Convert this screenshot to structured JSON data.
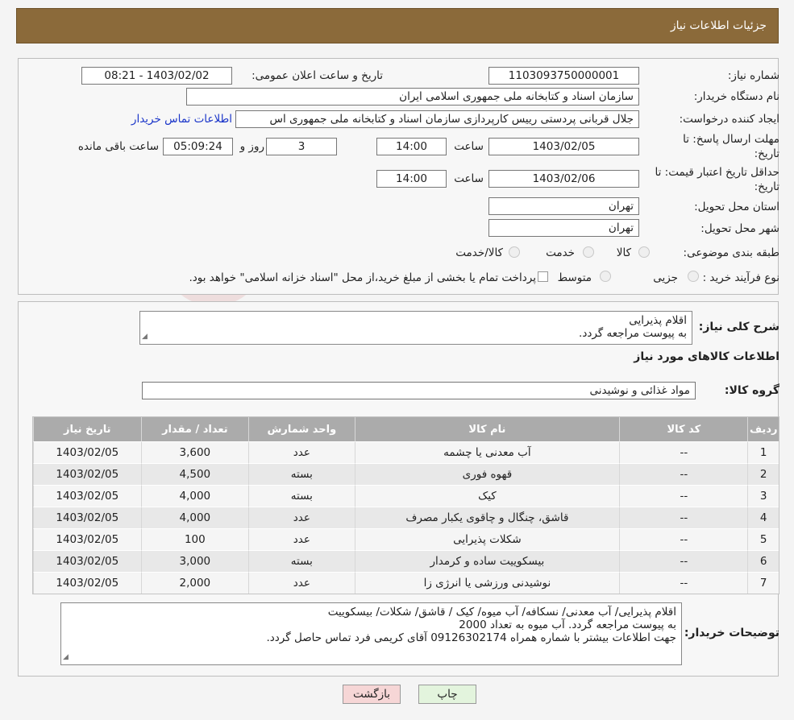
{
  "header": {
    "title": "جزئیات اطلاعات نیاز"
  },
  "form": {
    "need_number_label": "شماره نیاز:",
    "need_number": "1103093750000001",
    "announce_label": "تاریخ و ساعت اعلان عمومی:",
    "announce_value": "1403/02/02 - 08:21",
    "buyer_org_label": "نام دستگاه خریدار:",
    "buyer_org": "سازمان اسناد و کتابخانه ملی جمهوری اسلامی ایران",
    "requester_label": "ایجاد کننده درخواست:",
    "requester": "جلال قربانی پردستی رییس کارپردازی سازمان اسناد و کتابخانه ملی جمهوری اس",
    "contact_link": "اطلاعات تماس خریدار",
    "deadline_label_1": "مهلت ارسال پاسخ: تا",
    "deadline_label_2": "تاریخ:",
    "deadline_date": "1403/02/05",
    "time_label": "ساعت",
    "deadline_time": "14:00",
    "days_value": "3",
    "days_label": "روز و",
    "remaining_value": "05:09:24",
    "remaining_label": "ساعت باقی مانده",
    "validity_label_1": "حداقل تاریخ اعتبار قیمت: تا",
    "validity_label_2": "تاریخ:",
    "validity_date": "1403/02/06",
    "validity_time": "14:00",
    "province_label": "استان محل تحویل:",
    "province": "تهران",
    "city_label": "شهر محل تحویل:",
    "city": "تهران",
    "category_label": "طبقه بندی موضوعی:",
    "category_options": [
      "کالا",
      "خدمت",
      "کالا/خدمت"
    ],
    "process_label": "نوع فرآیند خرید :",
    "process_options": [
      "جزیی",
      "متوسط"
    ],
    "process_note": "پرداخت تمام یا بخشی از مبلغ خرید،از محل \"اسناد خزانه اسلامی\" خواهد بود."
  },
  "need_desc": {
    "label": "شرح کلی نیاز:",
    "lines": [
      "اقلام پذیرایی",
      "به پیوست مراجعه گردد."
    ]
  },
  "goods": {
    "section_title": "اطلاعات کالاهای مورد نیاز",
    "group_label": "گروه کالا:",
    "group_value": "مواد غذائی و نوشیدنی"
  },
  "table": {
    "headers": [
      "ردیف",
      "کد کالا",
      "نام کالا",
      "واحد شمارش",
      "تعداد / مقدار",
      "تاریخ نیاز"
    ],
    "rows": [
      [
        "1",
        "--",
        "آب معدنی یا چشمه",
        "عدد",
        "3,600",
        "1403/02/05"
      ],
      [
        "2",
        "--",
        "قهوه فوری",
        "بسته",
        "4,500",
        "1403/02/05"
      ],
      [
        "3",
        "--",
        "کیک",
        "بسته",
        "4,000",
        "1403/02/05"
      ],
      [
        "4",
        "--",
        "قاشق، چنگال و چاقوی یکبار مصرف",
        "عدد",
        "4,000",
        "1403/02/05"
      ],
      [
        "5",
        "--",
        "شکلات پذیرایی",
        "عدد",
        "100",
        "1403/02/05"
      ],
      [
        "6",
        "--",
        "بیسکوییت ساده و کرمدار",
        "بسته",
        "3,000",
        "1403/02/05"
      ],
      [
        "7",
        "--",
        "نوشیدنی ورزشی یا انرژی زا",
        "عدد",
        "2,000",
        "1403/02/05"
      ]
    ]
  },
  "buyer_notes": {
    "label": "توضیحات خریدار:",
    "lines": [
      "اقلام پذیرایی/ آب معدنی/ نسکافه/ آب میوه/ کیک / قاشق/ شکلات/ بیسکوییت",
      "به پیوست مراجعه گردد. آب میوه به تعداد 2000",
      "جهت اطلاعات بیشتر با شماره همراه 09126302174 آقای کریمی فرد تماس حاصل گردد."
    ]
  },
  "buttons": {
    "print": "چاپ",
    "back": "بازگشت"
  },
  "colors": {
    "header": "#8b6a3a",
    "back_button": "#f6d6d6",
    "print_button": "#e3f4dd",
    "link": "#1a35c9"
  }
}
